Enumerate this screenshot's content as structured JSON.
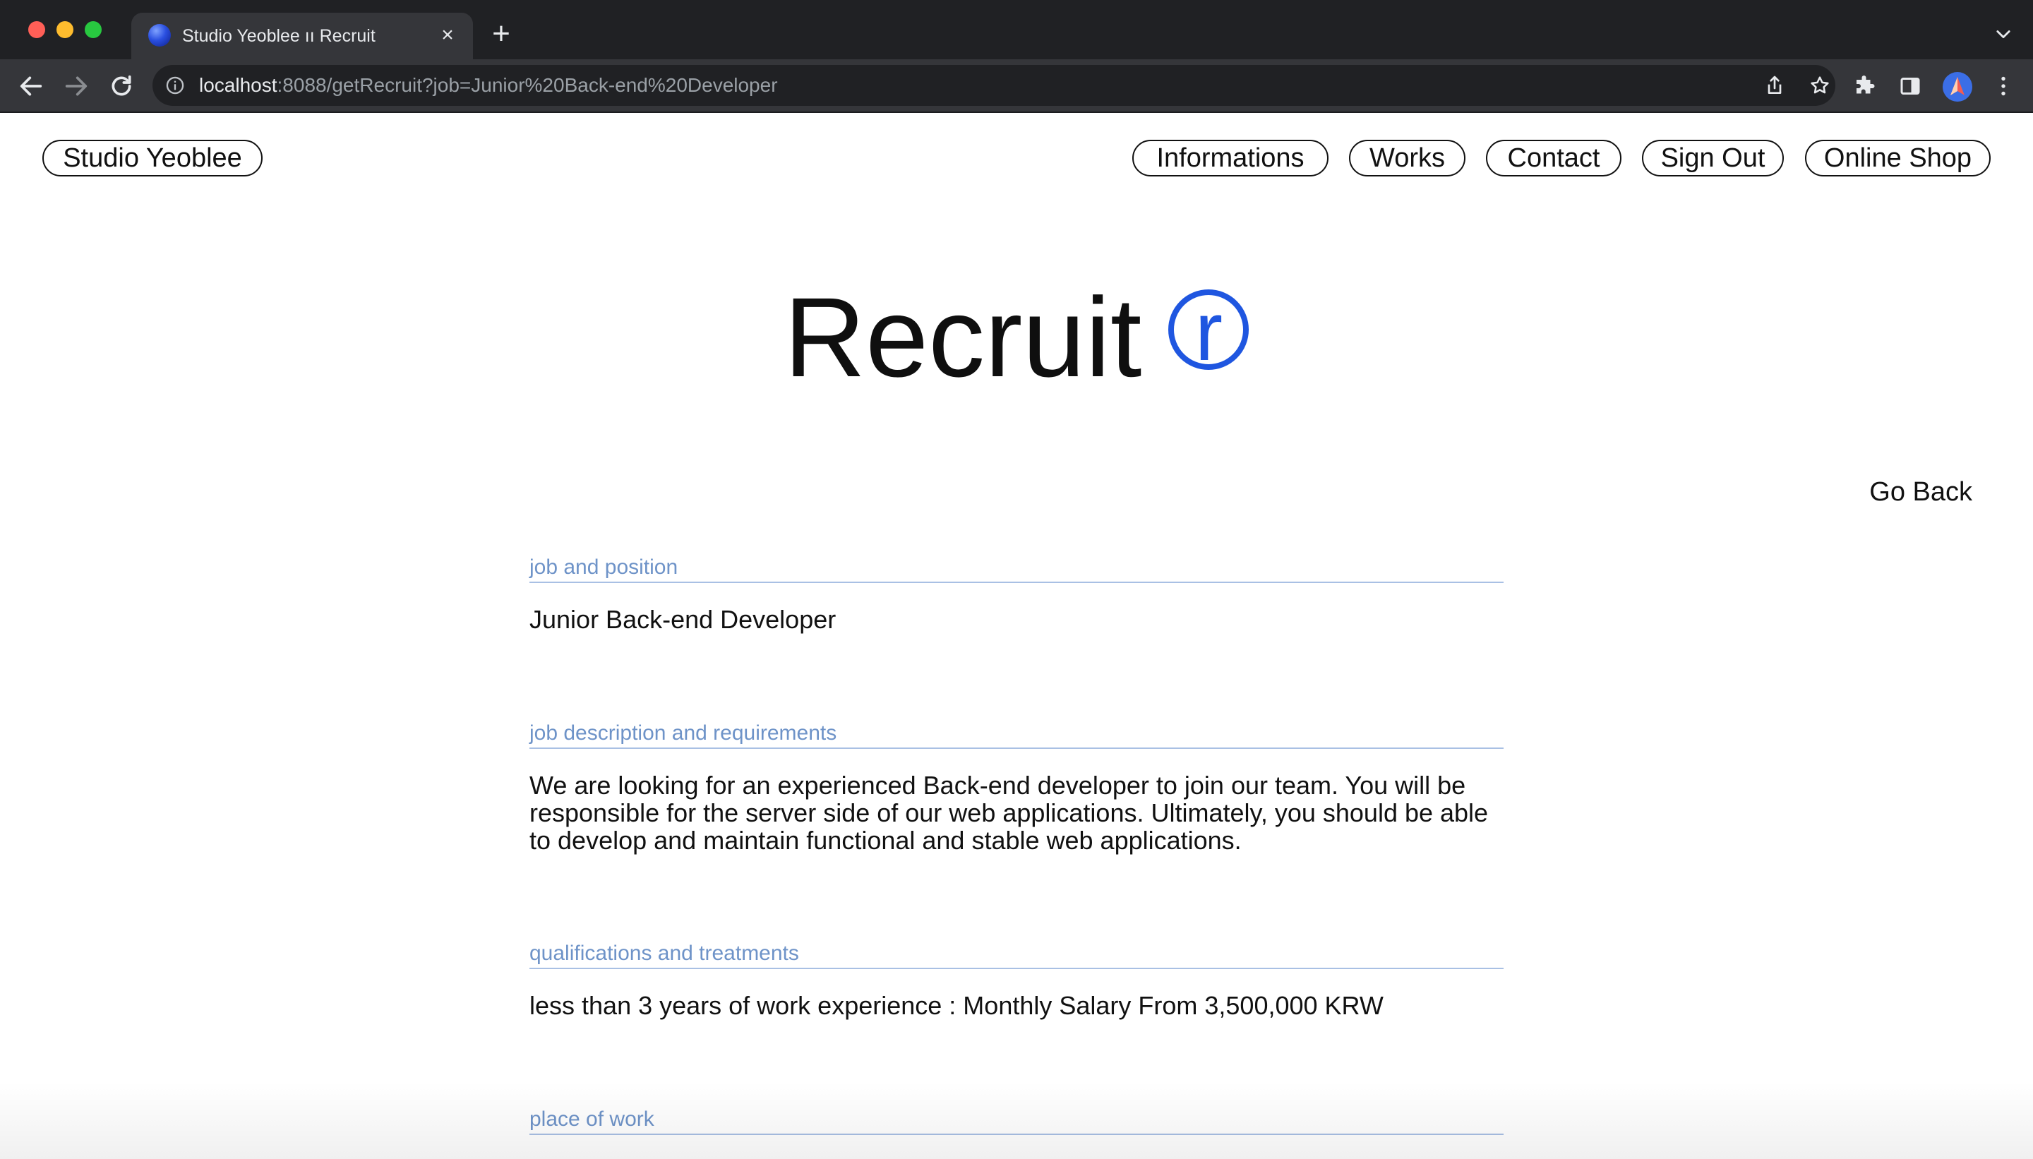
{
  "browser": {
    "tab_title": "Studio Yeoblee ıı Recruit",
    "url_host": "localhost",
    "url_rest": ":8088/getRecruit?job=Junior%20Back-end%20Developer"
  },
  "nav": {
    "brand": "Studio Yeoblee",
    "items": [
      {
        "label": "Informations"
      },
      {
        "label": "Works"
      },
      {
        "label": "Contact"
      },
      {
        "label": "Sign Out"
      },
      {
        "label": "Online Shop"
      }
    ]
  },
  "hero": {
    "title": "Recruit",
    "badge": "r"
  },
  "go_back": "Go Back",
  "sections": [
    {
      "label": "job and position",
      "value": "Junior Back-end Developer"
    },
    {
      "label": "job description and requirements",
      "value": "We are looking for an experienced Back-end developer to join our team. You will be responsible for the server side of our web applications. Ultimately, you should be able to develop and maintain functional and stable web applications."
    },
    {
      "label": "qualifications and treatments",
      "value": "less than 3 years of work experience : Monthly Salary From 3,500,000 KRW"
    },
    {
      "label": "place of work",
      "value": ""
    }
  ],
  "colors": {
    "accent": "#1f56e0",
    "section_label": "#6e93c8",
    "chrome_bg": "#202124"
  }
}
